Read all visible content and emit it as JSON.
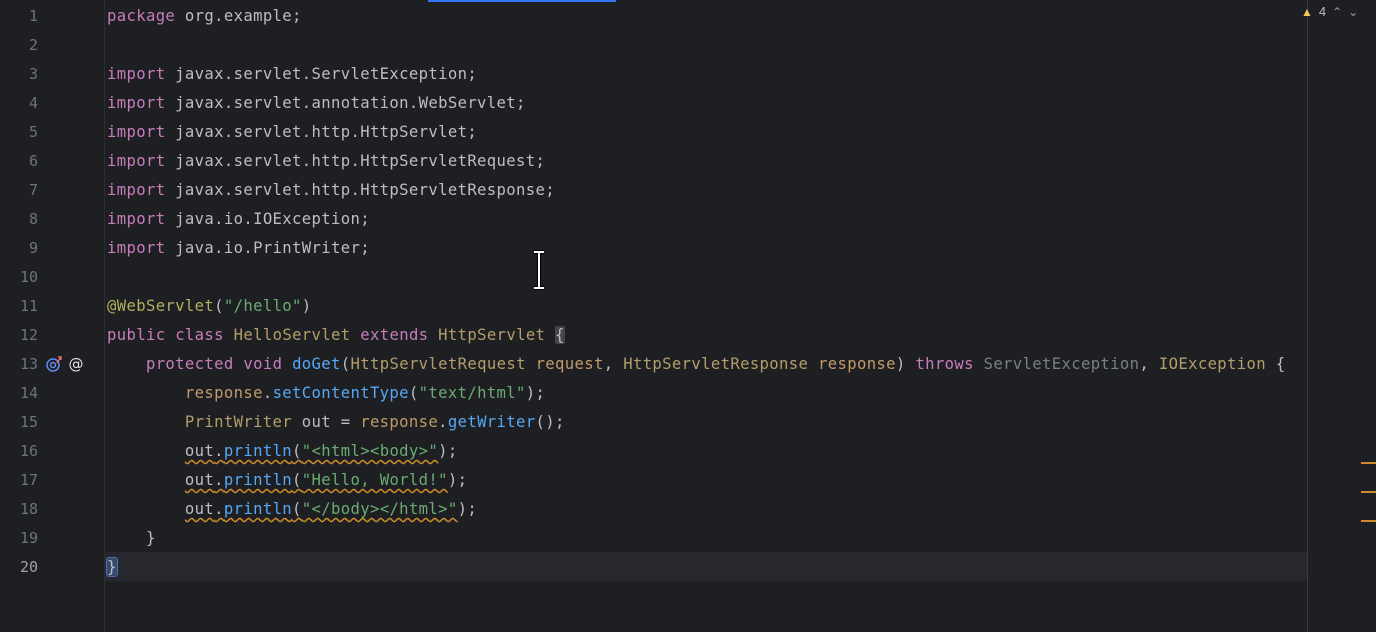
{
  "line_numbers": [
    "1",
    "2",
    "3",
    "4",
    "5",
    "6",
    "7",
    "8",
    "9",
    "10",
    "11",
    "12",
    "13",
    "14",
    "15",
    "16",
    "17",
    "18",
    "19",
    "20"
  ],
  "inspection": {
    "warning_count": "4",
    "warn_icon": "warning-triangle-icon",
    "up_icon": "chevron-up-icon",
    "down_icon": "chevron-down-icon"
  },
  "gutter_icons": {
    "override": "↑",
    "annotation": "@"
  },
  "code": {
    "l1": {
      "kw": "package",
      "rest": " org.example;"
    },
    "l3": {
      "kw": "import",
      "rest": " javax.servlet.ServletException;"
    },
    "l4": {
      "kw": "import",
      "rest": " javax.servlet.annotation.WebServlet;"
    },
    "l5": {
      "kw": "import",
      "rest": " javax.servlet.http.HttpServlet;"
    },
    "l6": {
      "kw": "import",
      "rest": " javax.servlet.http.HttpServletRequest;"
    },
    "l7": {
      "kw": "import",
      "rest": " javax.servlet.http.HttpServletResponse;"
    },
    "l8": {
      "kw": "import",
      "rest": " java.io.IOException;"
    },
    "l9": {
      "kw": "import",
      "rest": " java.io.PrintWriter;"
    },
    "l11": {
      "ann": "@WebServlet",
      "open": "(",
      "str": "\"/hello\"",
      "close": ")"
    },
    "l12": {
      "kw1": "public",
      "kw2": "class",
      "name": "HelloServlet",
      "kw3": "extends",
      "parent": "HttpServlet",
      "brace": "{"
    },
    "l13": {
      "kw1": "protected",
      "kw2": "void",
      "fn": "doGet",
      "open": "(",
      "t1": "HttpServletRequest",
      "p1": "request",
      "comma1": ", ",
      "t2": "HttpServletResponse",
      "p2": "response",
      "close": ") ",
      "kw3": "throws",
      "e1": "ServletException",
      "comma2": ", ",
      "e2": "IOException",
      "brace": "{"
    },
    "l14": {
      "obj": "response",
      "dot": ".",
      "fn": "setContentType",
      "open": "(",
      "str": "\"text/html\"",
      "close": ");"
    },
    "l15": {
      "type": "PrintWriter",
      "mid": " out = ",
      "obj": "response",
      "dot": ".",
      "fn": "getWriter",
      "close": "();"
    },
    "l16": {
      "obj": "out",
      "dot": ".",
      "fn": "println",
      "open": "(",
      "str": "\"<html><body>\"",
      "close": ");"
    },
    "l17": {
      "obj": "out",
      "dot": ".",
      "fn": "println",
      "open": "(",
      "str": "\"Hello, World!\"",
      "close": ");"
    },
    "l18": {
      "obj": "out",
      "dot": ".",
      "fn": "println",
      "open": "(",
      "str": "\"</body></html>\"",
      "close": ");"
    },
    "l19": {
      "brace": "}"
    },
    "l20": {
      "brace": "}"
    }
  },
  "colors": {
    "keyword": "#cf8e6d",
    "import_keyword": "#c77dbb",
    "string": "#6aab73",
    "function": "#56a8f5",
    "annotation": "#b3ae60",
    "warning": "#d4882c"
  }
}
